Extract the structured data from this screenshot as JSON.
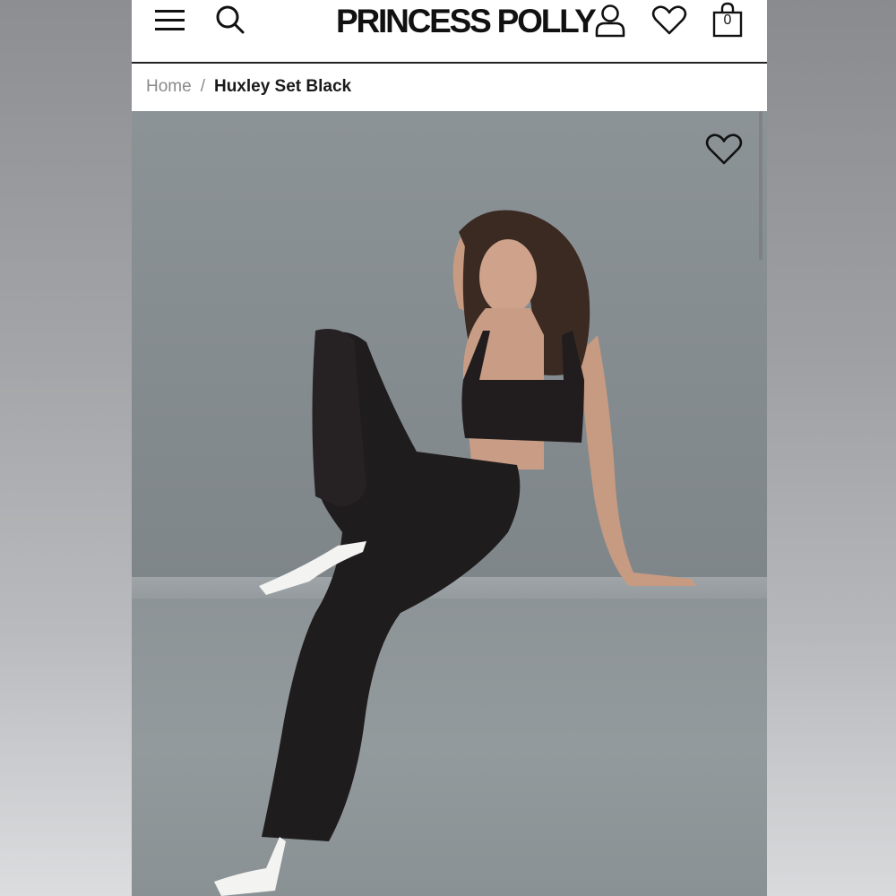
{
  "header": {
    "logo": "PRINCESS POLLY",
    "bag_count": "0",
    "icons": {
      "menu": "hamburger-menu-icon",
      "search": "search-icon",
      "account": "user-icon",
      "wishlist": "heart-icon",
      "bag": "shopping-bag-icon"
    }
  },
  "breadcrumb": {
    "home": "Home",
    "separator": "/",
    "current": "Huxley Set Black"
  },
  "hero": {
    "wishlist_icon": "heart-outline-icon"
  },
  "colors": {
    "text": "#111111",
    "breadcrumb_muted": "#8a8a8a",
    "wall": "#878e92",
    "outfit": "#1f1c1d"
  }
}
